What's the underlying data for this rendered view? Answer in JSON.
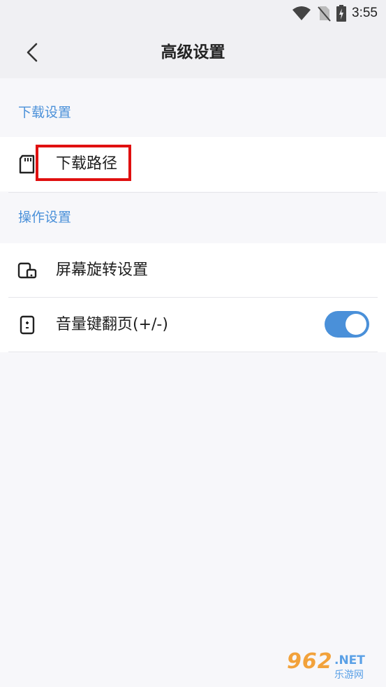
{
  "status_bar": {
    "time": "3:55"
  },
  "header": {
    "title": "高级设置"
  },
  "sections": {
    "download": {
      "label": "下载设置",
      "items": [
        {
          "label": "下载路径",
          "icon": "sd-card-icon"
        }
      ]
    },
    "operation": {
      "label": "操作设置",
      "items": [
        {
          "label": "屏幕旋转设置",
          "icon": "screen-rotation-icon"
        },
        {
          "label": "音量键翻页(+/-)",
          "icon": "phone-volume-icon",
          "toggle_on": true
        }
      ]
    }
  },
  "colors": {
    "accent": "#4a90d9",
    "highlight": "#e01010"
  },
  "watermark": {
    "brand": "962",
    "domain": ".NET",
    "subtitle": "乐游网"
  }
}
